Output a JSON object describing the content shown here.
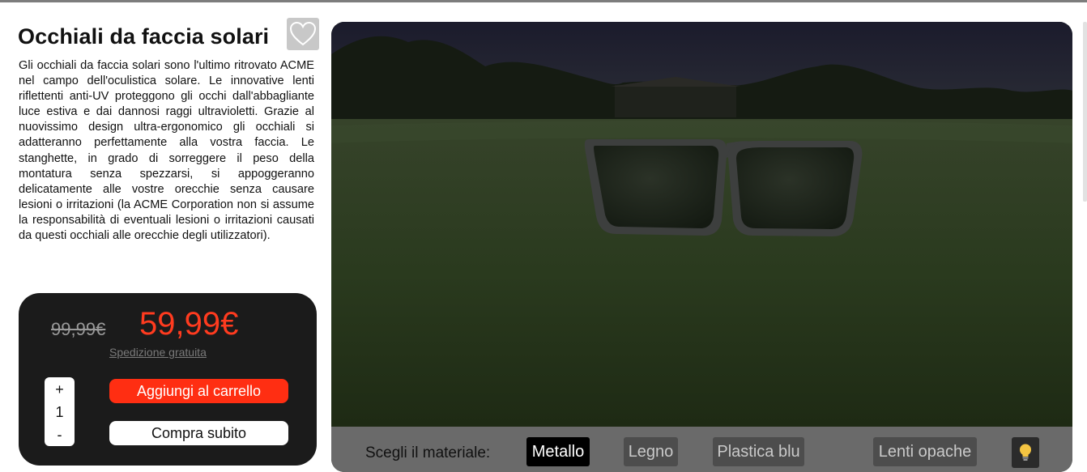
{
  "product": {
    "title": "Occhiali da faccia solari",
    "description": "Gli occhiali da faccia solari sono l'ultimo ritrovato ACME nel campo dell'oculistica solare. Le innovative lenti riflettenti anti-UV proteggono gli occhi dall'abbagliante luce estiva e dai dannosi raggi ultravioletti. Grazie al nuovissimo design ultra-ergonomico gli occhiali si adatteranno perfettamente alla vostra faccia. Le stanghette, in grado di sorreggere il peso della montatura senza spezzarsi, si appoggeranno delicatamente alle vostre orecchie senza causare lesioni o irritazioni (la ACME Corporation non si assume la responsabilità di eventuali lesioni o irritazioni causati da questi occhiali alle orecchie degli utilizzatori).",
    "favorite_icon": "heart-icon"
  },
  "pricing": {
    "old_price": "99,99€",
    "new_price": "59,99€",
    "shipping": "Spedizione gratuita",
    "price_color": "#ff3b1f"
  },
  "quantity": {
    "plus": "+",
    "value": "1",
    "minus": "-"
  },
  "actions": {
    "add_to_cart": "Aggiungi al carrello",
    "buy_now": "Compra subito",
    "accent": "#ff2e12"
  },
  "viewer": {
    "material_label": "Scegli il materiale:",
    "materials": [
      {
        "label": "Metallo",
        "active": true
      },
      {
        "label": "Legno",
        "active": false
      },
      {
        "label": "Plastica blu",
        "active": false
      },
      {
        "label": "Lenti opache",
        "active": false
      }
    ],
    "light_icon": "lightbulb-icon"
  }
}
